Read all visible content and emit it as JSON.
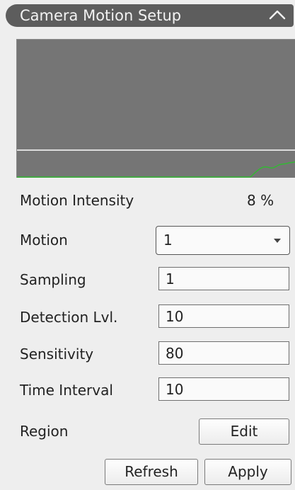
{
  "header": {
    "title": "Camera Motion Setup",
    "toggle_icon": "chevron-up-icon"
  },
  "graph": {
    "background": "#757575",
    "line_color": "#ffffff",
    "trace_color": "#33b833"
  },
  "intensity": {
    "label": "Motion Intensity",
    "value": "8 %"
  },
  "motion": {
    "label": "Motion",
    "selected": "1"
  },
  "sampling": {
    "label": "Sampling",
    "value": "1"
  },
  "detection": {
    "label": "Detection Lvl.",
    "value": "10"
  },
  "sensitivity": {
    "label": "Sensitivity",
    "value": "80"
  },
  "time_interval": {
    "label": "Time Interval",
    "value": "10"
  },
  "region": {
    "label": "Region",
    "edit_label": "Edit"
  },
  "actions": {
    "refresh_label": "Refresh",
    "apply_label": "Apply"
  }
}
